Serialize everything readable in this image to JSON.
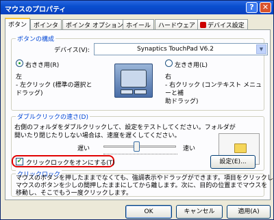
{
  "window": {
    "title": "マウスのプロパティ",
    "help_glyph": "?",
    "close_glyph": "✕"
  },
  "tabs": [
    "ボタン",
    "ポインタ",
    "ポインタ オプション",
    "ホイール",
    "ハードウェア",
    "デバイス設定"
  ],
  "button_config": {
    "group_label": "ボタンの構成",
    "device_label": "デバイス(V):",
    "device_value": "Synaptics TouchPad V6.2",
    "right_handed": "右きき用(R)",
    "left_handed": "左きき用(L)",
    "left_desc": "左\n - 左クリック (標準の選択と\nドラッグ)",
    "right_desc": "右\n - 右クリック (コンテキスト メニューと補\n助ドラッグ)"
  },
  "double_click": {
    "group_label": "ダブルクリックの速さ(D)",
    "desc_line1": "右側のフォルダをダブルクリックして、設定をテストしてください。フォルダが",
    "desc_line2": "開いたり閉じたりしない場合は、速度を遅くしてください。",
    "slow": "遅い",
    "fast": "速い"
  },
  "click_lock": {
    "group_label": "クリックロック",
    "checkbox_label": "クリックロックをオンにする(T)",
    "checked": true,
    "settings_button": "設定(E)...",
    "desc_line1": "マウスのボタンを押したままでなくても、強調表示やドラッグができます。項目をクリックし、",
    "desc_line2": "マウスのボタンを少しの間押したままにしてから離します。次に、目的の位置までマウスを",
    "desc_line3": "移動し、そこでもう一度クリックします。"
  },
  "footer": {
    "ok": "OK",
    "cancel": "キャンセル",
    "apply": "適用(A)"
  },
  "colors": {
    "highlight": "#e00000",
    "title_bar": "#0a4fcf",
    "group_label": "#0046d5"
  }
}
